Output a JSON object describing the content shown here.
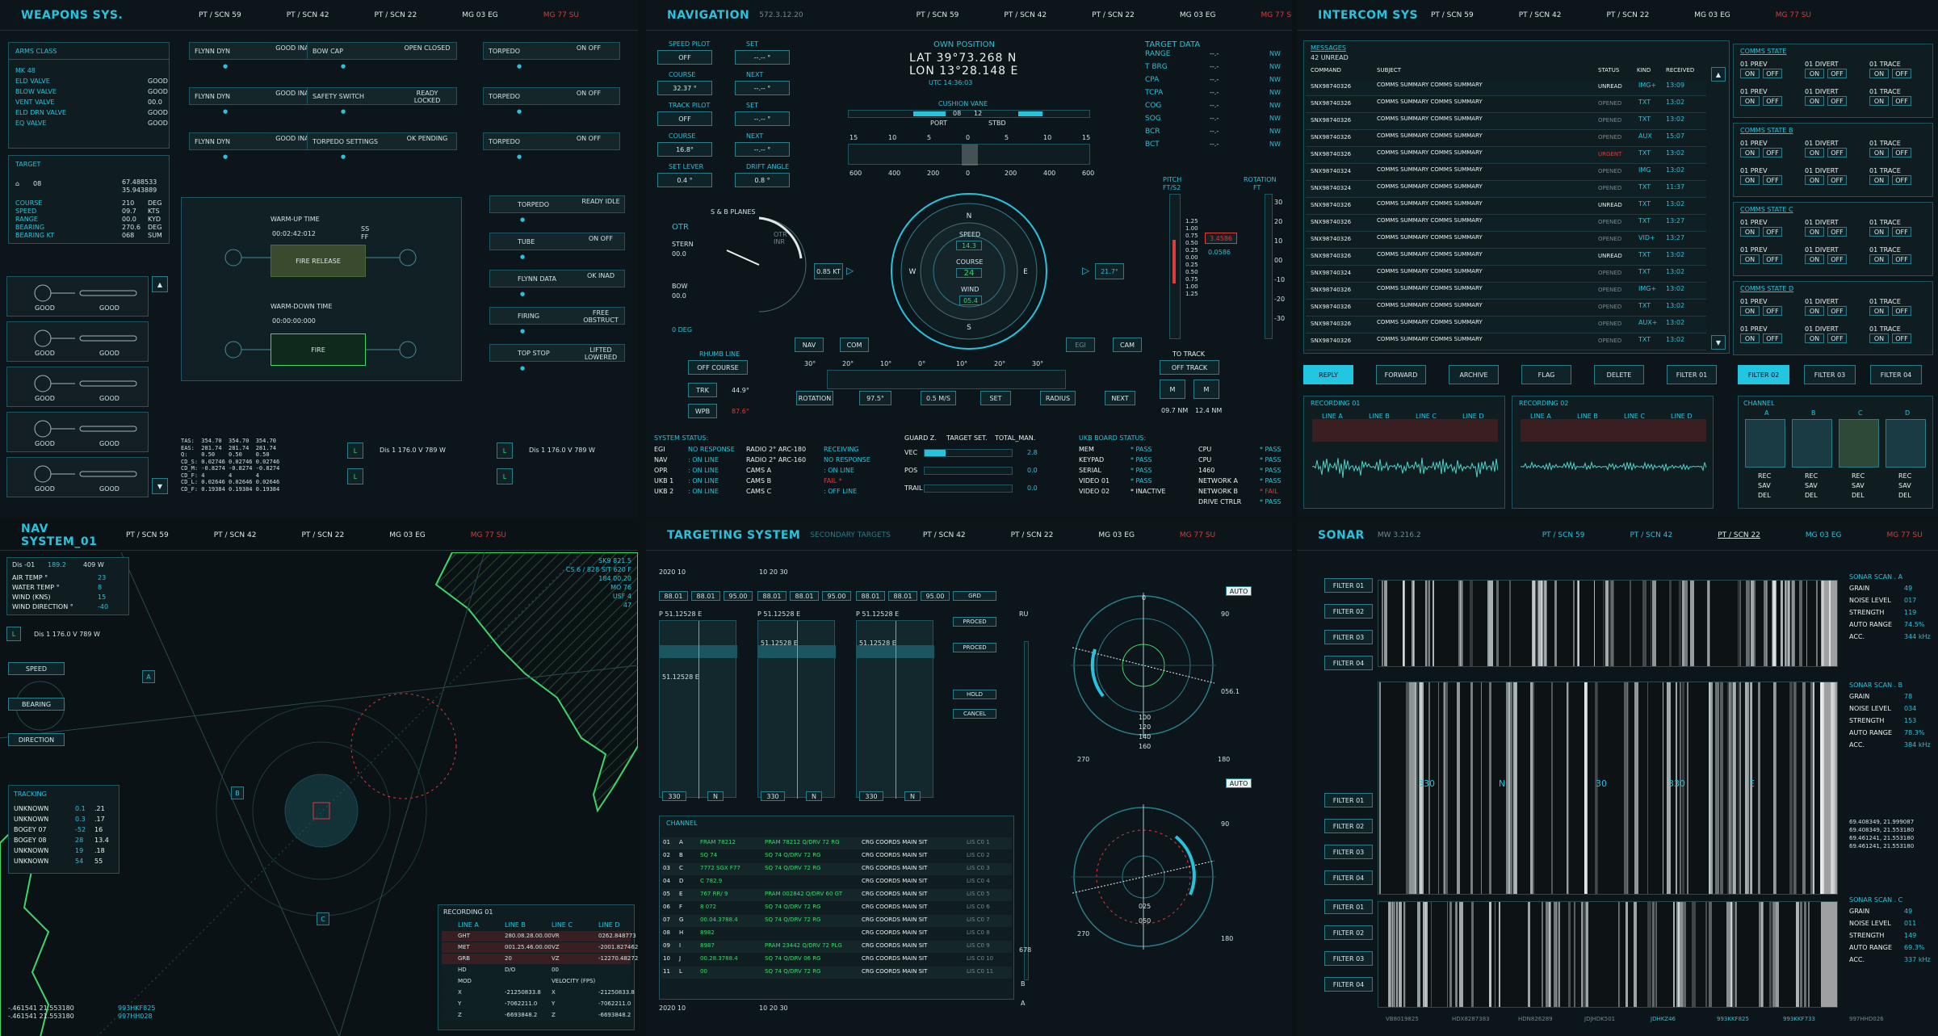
{
  "shared_tabs": [
    "PT / SCN 59",
    "PT / SCN 42",
    "PT / SCN 22",
    "MG 03 EG",
    "MG 77 SU"
  ],
  "weapons": {
    "title": "WEAPONS SYS.",
    "arms_class": "ARMS CLASS",
    "arms_rows": [
      [
        "MK 48",
        ""
      ],
      [
        "ELD VALVE",
        "GOOD"
      ],
      [
        "BLOW VALVE",
        "GOOD"
      ],
      [
        "VENT VALVE",
        "00.0"
      ],
      [
        "ELD DRN VALVE",
        "GOOD"
      ],
      [
        "EQ VALVE",
        "GOOD"
      ]
    ],
    "target_title": "TARGET",
    "target_id": "08",
    "target_coords": [
      "67.488533",
      "35.943889"
    ],
    "target_rows": [
      [
        "COURSE",
        "210",
        "DEG"
      ],
      [
        "SPEED",
        "09.7",
        "KTS"
      ],
      [
        "RANGE",
        "00.0",
        "KYD"
      ],
      [
        "BEARING",
        "270.6",
        "DEG"
      ],
      [
        "BEARING KT",
        "068",
        "SUM"
      ]
    ],
    "status_boxes": [
      [
        "FLYNN DYN",
        "GOOD INAD"
      ],
      [
        "BOW CAP",
        "OPEN CLOSED"
      ],
      [
        "TORPEDO",
        "ON OFF"
      ],
      [
        "FLYNN DYN",
        "GOOD INAD"
      ],
      [
        "SAFETY SWITCH",
        "READY LOCKED"
      ],
      [
        "TORPEDO",
        "ON OFF"
      ],
      [
        "FLYNN DYN",
        "GOOD INAD"
      ],
      [
        "TORPEDO SETTINGS",
        "OK PENDING"
      ],
      [
        "TORPEDO",
        "ON OFF"
      ]
    ],
    "warmup": {
      "warm_up": "WARM-UP TIME",
      "warm_val": "00:02:42:012",
      "fire_release": "FIRE RELEASE",
      "warm_down": "WARM-DOWN TIME",
      "down_val": "00:00:00:000",
      "fire": "FIRE",
      "ss": "SS",
      "ff": "FF"
    },
    "right_list": [
      [
        "TORPEDO",
        "READY IDLE"
      ],
      [
        "TUBE",
        "ON OFF"
      ],
      [
        "FLYNN DATA",
        "OK INAD"
      ],
      [
        "FIRING",
        "FREE OBSTRUCT"
      ],
      [
        "TOP STOP",
        "LIFTED LOWERED"
      ]
    ],
    "good": "GOOD",
    "tas_block": "TAS:  354.70  354.70  354.70\nEAS:  281.74  281.74  281.74\nQ:    0.50    0.50    0.50\nCD_S: 0.02746 0.02746 0.02746\nCD_M: -0.8274 -0.8274 -0.8274\nCD_F: 4       4       4\nCD_L: 0.02646 0.02646 0.02646\nCD_F: 0.19384 0.19384 0.19384",
    "dis_lines": [
      "Dis  1    176.0  V  789  W",
      "Dis  1    176.0  V  789  W"
    ]
  },
  "nav": {
    "title": "NAVIGATION",
    "sub": "572.3.12.20",
    "left_fields": [
      [
        "SPEED PILOT",
        "OFF"
      ],
      [
        "SET",
        "--.-- °"
      ],
      [
        "COURSE",
        "32.37 °"
      ],
      [
        "NEXT",
        "--.-- °"
      ],
      [
        "TRACK PILOT",
        "OFF"
      ],
      [
        "SET",
        "--.-- °"
      ],
      [
        "COURSE",
        "16.8°"
      ],
      [
        "NEXT",
        "--.-- °"
      ],
      [
        "SET LEVER",
        "0.4 °"
      ],
      [
        "DRIFT ANGLE",
        "0.8 °"
      ]
    ],
    "own_position": "OWN POSITION",
    "lat": "LAT   39°73.268 N",
    "lon": "LON   13°28.148 E",
    "utc": "UTC    14:36:03",
    "cushion": "CUSHION VANE",
    "port": "PORT",
    "stbd": "STBD",
    "cv_l": "08",
    "cv_r": "12",
    "scale_top": [
      "15",
      "10",
      "5",
      "0",
      "5",
      "10",
      "15"
    ],
    "scale_bot": [
      "600",
      "400",
      "200",
      "0",
      "200",
      "400",
      "600"
    ],
    "target_data": "TARGET DATA",
    "td_rows": [
      [
        "RANGE",
        "--.-",
        "NW"
      ],
      [
        "T BRG",
        "--.-",
        "NW"
      ],
      [
        "CPA",
        "--.-",
        "NW"
      ],
      [
        "TCPA",
        "--.-",
        "NW"
      ],
      [
        "COG",
        "--.-",
        "NW"
      ],
      [
        "SOG",
        "--.-",
        "NW"
      ],
      [
        "BCR",
        "--.-",
        "NW"
      ],
      [
        "BCT",
        "--.-",
        "NW"
      ]
    ],
    "otr": "OTR",
    "stern": "STERN",
    "stern_v": "00.0",
    "bow": "BOW",
    "bow_v": "00.0",
    "deg0": "0 DEG",
    "sb_planes": "S & B PLANES",
    "otr_inr": "OTR INR",
    "speed": "SPEED",
    "speed_v": "14.3",
    "course": "COURSE",
    "course_v": "24",
    "wind": "WIND",
    "wind_v": "05.4",
    "kt": "0.85 KT",
    "deg": "21.7°",
    "pitch": "PITCH",
    "pitch_u": "FT/S2",
    "rotation": "ROTATION",
    "rot_u": "FT",
    "pitch_v": "3.4586",
    "pitch_v2": "0.0586",
    "pitch_ticks": [
      "1.25",
      "1.00",
      "0.75",
      "0.50",
      "0.25",
      "0.00",
      "0.25",
      "0.50",
      "0.75",
      "1.00",
      "1.25"
    ],
    "rot_ticks": [
      "30",
      "20",
      "10",
      "00",
      "-10",
      "-20",
      "-30"
    ],
    "navc": "NAV",
    "com": "COM",
    "egi": "EGI",
    "cam": "CAM",
    "bearing_ticks": [
      "30°",
      "20°",
      "10°",
      "0°",
      "10°",
      "20°",
      "30°"
    ],
    "rhumb": "RHUMB LINE",
    "off_course": "OFF COURSE",
    "trk": "TRK",
    "trk_v": "44.9°",
    "wpb": "WPB",
    "wpb_v": "87.6°",
    "to_track": "TO TRACK",
    "off_track": "OFF TRACK",
    "m": "M",
    "nm1": "09.7 NM",
    "nm2": "12.4 NM",
    "rotation_b": "ROTATION",
    "rot_b_v": "97.5°",
    "ms": "0.5 M/S",
    "set_b": "SET",
    "radius": "RADIUS",
    "next_b": "NEXT",
    "system_status": "SYSTEM STATUS:",
    "sys_rows": [
      [
        "EGI",
        "NO RESPONSE",
        "RADIO 2° ARC-180",
        "RECEIVING"
      ],
      [
        "NAV",
        ": ON LINE",
        "RADIO 2° ARC-160",
        "NO RESPONSE"
      ],
      [
        "OPR",
        ": ON LINE",
        "CAMS A",
        ": ON LINE"
      ],
      [
        "UKB 1",
        ": ON LINE",
        "CAMS B",
        "FAIL *"
      ],
      [
        "UKB 2",
        ": ON LINE",
        "CAMS C",
        ": OFF LINE"
      ]
    ],
    "guard": "GUARD Z.",
    "target_set": "TARGET SET.",
    "total_man": "TOTAL_MAN.",
    "guard_rows": [
      [
        "VEC",
        "2.8"
      ],
      [
        "POS",
        "0.0"
      ],
      [
        "TRAIL",
        "0.0"
      ]
    ],
    "ukb": "UKB BOARD STATUS:",
    "ukb_rows": [
      [
        "MEM",
        "* PASS",
        "CPU",
        "* PASS"
      ],
      [
        "KEYPAD",
        "* PASS",
        "CPU",
        "* PASS"
      ],
      [
        "SERIAL",
        "* PASS",
        "1460",
        "* PASS"
      ],
      [
        "VIDEO 01",
        "* PASS",
        "NETWORK A",
        "* PASS"
      ],
      [
        "VIDEO 02",
        "* INACTIVE",
        "NETWORK B",
        "* FAIL"
      ],
      [
        "",
        "",
        "DRIVE CTRLR",
        "* PASS"
      ]
    ]
  },
  "intercom": {
    "title": "INTERCOM SYS",
    "messages": "MESSAGES",
    "unread": "42 UNREAD",
    "cols": [
      "COMMAND",
      "SUBJECT",
      "STATUS",
      "KIND",
      "RECEIVED"
    ],
    "msg_ids": [
      "SNX98740326",
      "SNX98740326",
      "SNX98740326",
      "SNX98740326",
      "SNX98740326",
      "SNX98740324",
      "SNX98740324",
      "SNX98740326",
      "SNX98740326",
      "SNX98740326",
      "SNX98740326",
      "SNX98740324",
      "SNX98740326",
      "SNX98740326",
      "SNX98740326",
      "SNX98740326"
    ],
    "msg_subject": "COMMS SUMMARY COMMS SUMMARY",
    "msg_status": [
      "UNREAD",
      "OPENED",
      "OPENED",
      "OPENED",
      "URGENT",
      "OPENED",
      "OPENED",
      "UNREAD",
      "OPENED",
      "OPENED",
      "UNREAD",
      "OPENED",
      "OPENED",
      "OPENED",
      "OPENED",
      "OPENED"
    ],
    "msg_kind": [
      "IMG+",
      "TXT",
      "TXT",
      "AUX",
      "TXT",
      "IMG",
      "TXT",
      "TXT",
      "TXT",
      "VID+",
      "TXT",
      "TXT",
      "IMG+",
      "TXT",
      "AUX+",
      "TXT"
    ],
    "msg_time": [
      "13:09",
      "13:02",
      "13:02",
      "15:07",
      "13:02",
      "13:02",
      "11:37",
      "13:02",
      "13:27",
      "13:27",
      "13:02",
      "13:02",
      "13:02",
      "13:02",
      "13:02",
      "13:02"
    ],
    "actions": [
      "REPLY",
      "FORWARD",
      "ARCHIVE",
      "FLAG",
      "DELETE",
      "FILTER 01",
      "FILTER 02",
      "FILTER 03",
      "FILTER 04"
    ],
    "comms": [
      "COMMS STATE",
      "COMMS STATE B",
      "COMMS STATE C",
      "COMMS STATE D"
    ],
    "comm_labels": [
      "01 PREV",
      "01 DIVERT",
      "01 TRACE"
    ],
    "on": "ON",
    "off": "OFF",
    "rec1": "RECORDING 01",
    "rec2": "RECORDING 02",
    "lines": [
      "LINE A",
      "LINE B",
      "LINE C",
      "LINE D"
    ],
    "channel": "CHANNEL",
    "ch": [
      "A",
      "B",
      "C",
      "D"
    ],
    "rec": "REC",
    "sav": "SAV",
    "del": "DEL"
  },
  "navsys": {
    "title": "NAV SYSTEM_01",
    "dis": "Dis -01",
    "dis_v": "189.2",
    "v": "V",
    "w": "409 W",
    "env": [
      [
        "AIR TEMP °",
        "23"
      ],
      [
        "WATER TEMP °",
        "8"
      ],
      [
        "WIND (KNS)",
        "15"
      ],
      [
        "WIND DIRECTION °",
        "-40"
      ]
    ],
    "l": "L",
    "dis2": "Dis  1   176.0  V  789  W",
    "speed": "SPEED",
    "bearing": "BEARING",
    "direction": "DIRECTION",
    "tracking": "TRACKING",
    "track_rows": [
      [
        "UNKNOWN",
        "0.1",
        ".21"
      ],
      [
        "UNKNOWN",
        "0.3",
        ".17"
      ],
      [
        "BOGEY 07",
        "-52",
        "16"
      ],
      [
        "BOGEY 08",
        "28",
        "13.4"
      ],
      [
        "UNKNOWN",
        "19",
        ".18"
      ],
      [
        "UNKNOWN",
        "54",
        "55"
      ]
    ],
    "marks": [
      "A",
      "B",
      "C"
    ],
    "rec": "RECORDING 01",
    "rec_cols": [
      "LINE A",
      "LINE B",
      "LINE C",
      "LINE D"
    ],
    "rec_rows": [
      [
        "GHT",
        "280.08.28.00.00",
        "VR",
        "0262.848773"
      ],
      [
        "MET",
        "001.25.46.00.00",
        "VZ",
        "-2001.827462"
      ],
      [
        "GRB",
        "20",
        "VZ",
        "-12270.482723"
      ],
      [
        "HD",
        "D/O",
        "00",
        ""
      ],
      [
        "MOD",
        "",
        "VELOCITY (FPS)",
        ""
      ],
      [
        "X",
        "-21250833.8",
        "X",
        "-21250833.8"
      ],
      [
        "Y",
        "-7062211.0",
        "Y",
        "-7062211.0"
      ],
      [
        "Z",
        "-6693848.2",
        "Z",
        "-6693848.2"
      ]
    ],
    "coords": [
      "-.461541  21.553180",
      "-.461541  21.553180"
    ],
    "coords_r": [
      "993HKF825",
      "997HH028"
    ],
    "top_right": [
      "SK9 821.5",
      "CS 6 / 828 SIT 620 F",
      "184 00.20",
      "MO 76",
      "USF 4",
      "47"
    ]
  },
  "targeting": {
    "title": "TARGETING SYSTEM",
    "secondary": "SECONDARY TARGETS",
    "stats": [
      "88.01",
      "88.01",
      "95.00"
    ],
    "p": "P 51.12528 E",
    "mid": "51.12528 E",
    "n": "N",
    "v330": "330",
    "opts": [
      "GRD",
      "PROCED",
      "PROCED",
      "HOLD",
      "CANCEL"
    ],
    "ru": "RU",
    "channel": "CHANNEL",
    "ch_rows": [
      [
        "01",
        "A",
        "FRAM 78212",
        "PRAM 78212 Q/DRV 72 RG",
        "CRG COORDS MAIN SIT",
        "LIS C0 1"
      ],
      [
        "02",
        "B",
        "SQ 74",
        "SQ 74 Q/DRV 72 RG",
        "CRG COORDS MAIN SIT",
        "LIS C0 2"
      ],
      [
        "03",
        "C",
        "7772 SGX F77",
        "SQ 74 Q/DRV 72 RG",
        "CRG COORDS MAIN SIT",
        "LIS C0 3"
      ],
      [
        "04",
        "D",
        "C 782.9",
        "",
        "CRG COORDS MAIN SIT",
        "LIS C0 4"
      ],
      [
        "05",
        "E",
        "767 RR/ 9",
        "PRAM 002842 Q/DRV 60 GT",
        "CRG COORDS MAIN SIT",
        "LIS C0 5"
      ],
      [
        "06",
        "F",
        "8 072",
        "SQ 74 Q/DRV 72 RG",
        "CRG COORDS MAIN SIT",
        "LIS C0 6"
      ],
      [
        "07",
        "G",
        "00.04.3788.4",
        "SQ 74 Q/DRV 72 RG",
        "CRG COORDS MAIN SIT",
        "LIS C0 7"
      ],
      [
        "08",
        "H",
        "8982",
        "",
        "CRG COORDS MAIN SIT",
        "LIS C0 8"
      ],
      [
        "09",
        "I",
        "8987",
        "PRAM 23442 Q/DRV 72 PLG",
        "CRG COORDS MAIN SIT",
        "LIS C0 9"
      ],
      [
        "10",
        "J",
        "00.28.3788.4",
        "SQ 74 Q/DRV 06 RG",
        "CRG COORDS MAIN SIT",
        "LIS C0 10"
      ],
      [
        "11",
        "L",
        "00",
        "SQ 74 Q/DRV 72 RG",
        "CRG COORDS MAIN SIT",
        "LIS C0 11"
      ]
    ],
    "ticks": [
      "2020 10",
      "10 20 30",
      "2020 10",
      "10 20 30"
    ],
    "radar1": [
      "90",
      "056.1",
      "180",
      "270",
      "0"
    ],
    "radar2": [
      "90",
      "180",
      "270",
      "025",
      "050"
    ],
    "radar_center": [
      "100",
      "120",
      "140",
      "160"
    ],
    "auto": "AUTO",
    "v678": "678",
    "b": "B",
    "a": "A"
  },
  "sonar": {
    "title": "SONAR",
    "sub": "MW 3.216.2",
    "filters": [
      "FILTER 01",
      "FILTER 02",
      "FILTER 03",
      "FILTER 04"
    ],
    "scan_a": "SONAR SCAN . A",
    "scan_b": "SONAR SCAN . B",
    "scan_c": "SONAR SCAN . C",
    "rows_a": [
      [
        "GRAIN",
        "49"
      ],
      [
        "NOISE LEVEL",
        "017"
      ],
      [
        "STRENGTH",
        "119"
      ],
      [
        "AUTO RANGE",
        "74.5%"
      ],
      [
        "ACC.",
        "344 kHz"
      ]
    ],
    "rows_b": [
      [
        "GRAIN",
        "78"
      ],
      [
        "NOISE LEVEL",
        "034"
      ],
      [
        "STRENGTH",
        "153"
      ],
      [
        "AUTO RANGE",
        "78.3%"
      ],
      [
        "ACC.",
        "384 kHz"
      ]
    ],
    "rows_c": [
      [
        "GRAIN",
        "49"
      ],
      [
        "NOISE LEVEL",
        "011"
      ],
      [
        "STRENGTH",
        "149"
      ],
      [
        "AUTO RANGE",
        "69.3%"
      ],
      [
        "ACC.",
        "337 kHz"
      ]
    ],
    "coords": [
      "69.408349, 21.999087",
      "69.408349, 21.553180",
      "69.461241, 21.553180",
      "69.461241, 21.553180"
    ],
    "axis": [
      "330",
      "N",
      "30",
      "330",
      "E"
    ],
    "bottom": [
      "VB8019825",
      "HDX8287383",
      "HDN826289",
      "JDJHDK501",
      "JDHKZ46",
      "993KKF825",
      "993KKF733",
      "997HHD026"
    ]
  }
}
